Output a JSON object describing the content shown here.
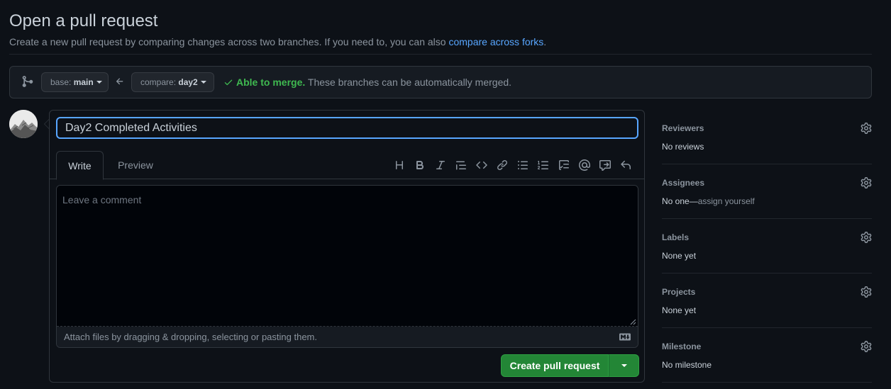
{
  "header": {
    "title": "Open a pull request",
    "subtitle_text": "Create a new pull request by comparing changes across two branches. If you need to, you can also ",
    "subtitle_link": "compare across forks",
    "subtitle_end": "."
  },
  "compare": {
    "base_prefix": "base: ",
    "base_branch": "main",
    "compare_prefix": "compare: ",
    "compare_branch": "day2",
    "merge_ok": "Able to merge.",
    "merge_text": " These branches can be automatically merged."
  },
  "form": {
    "title_value": "Day2 Completed Activities",
    "tab_write": "Write",
    "tab_preview": "Preview",
    "comment_placeholder": "Leave a comment",
    "attach_text": "Attach files by dragging & dropping, selecting or pasting them.",
    "submit_label": "Create pull request"
  },
  "toolbar_icons": [
    "heading-icon",
    "bold-icon",
    "italic-icon",
    "quote-icon",
    "code-icon",
    "link-icon",
    "unordered-list-icon",
    "ordered-list-icon",
    "task-list-icon",
    "mention-icon",
    "reference-icon",
    "reply-icon"
  ],
  "sidebar": {
    "sections": [
      {
        "heading": "Reviewers",
        "value": "No reviews",
        "muted": ""
      },
      {
        "heading": "Assignees",
        "value": "No one—",
        "muted": "assign yourself"
      },
      {
        "heading": "Labels",
        "value": "None yet",
        "muted": ""
      },
      {
        "heading": "Projects",
        "value": "None yet",
        "muted": ""
      },
      {
        "heading": "Milestone",
        "value": "No milestone",
        "muted": ""
      }
    ]
  },
  "colors": {
    "background": "#0d1117",
    "accent": "#58a6ff",
    "success": "#3fb950",
    "button": "#238636"
  }
}
